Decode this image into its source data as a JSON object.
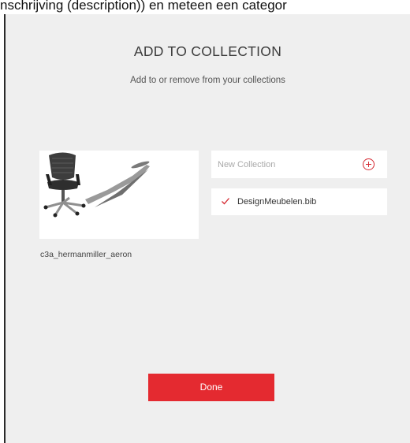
{
  "background": {
    "partial_text": "nschrijving (description)) en meteen een categor"
  },
  "dialog": {
    "title": "ADD TO COLLECTION",
    "subtitle": "Add to or remove from your collections",
    "model_name": "c3a_hermanmiller_aeron",
    "new_collection_placeholder": "New Collection",
    "add_icon": "plus-circle-icon",
    "collections": [
      {
        "label": "DesignMeubelen.bib",
        "checked": true
      }
    ],
    "done_label": "Done",
    "accent_color": "#e42a30"
  }
}
